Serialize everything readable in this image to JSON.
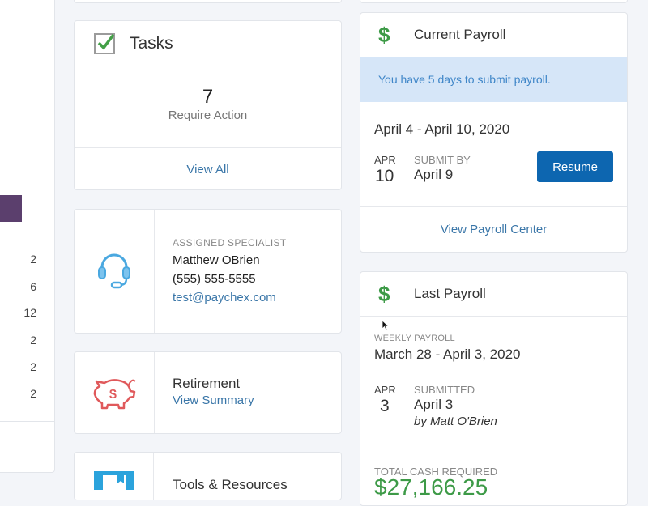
{
  "left_panel": {
    "values": [
      "2",
      "6",
      "12",
      "2",
      "2",
      "2"
    ],
    "swatch_color": "#5b3f6d"
  },
  "tasks": {
    "title": "Tasks",
    "count": "7",
    "count_label": "Require Action",
    "link": "View All"
  },
  "specialist": {
    "label": "ASSIGNED SPECIALIST",
    "name": "Matthew OBrien",
    "phone": "(555) 555-5555",
    "email": "test@paychex.com"
  },
  "retirement": {
    "title": "Retirement",
    "link": "View Summary"
  },
  "tools": {
    "title": "Tools & Resources"
  },
  "current_payroll": {
    "title": "Current Payroll",
    "banner": "You have 5 days to submit payroll.",
    "range": "April 4 - April 10, 2020",
    "month": "APR",
    "day": "10",
    "submit_label": "SUBMIT BY",
    "submit_date": "April 9",
    "resume_label": "Resume",
    "link": "View Payroll Center"
  },
  "last_payroll": {
    "title": "Last Payroll",
    "type_label": "WEEKLY PAYROLL",
    "range": "March 28 - April 3, 2020",
    "month": "APR",
    "day": "3",
    "status_label": "SUBMITTED",
    "status_date": "April 3",
    "by": "by  Matt O'Brien",
    "total_label": "TOTAL CASH REQUIRED",
    "total_amount": "$27,166.25"
  },
  "colors": {
    "accent": "#0d66b0",
    "dollar": "#3d9a47",
    "link": "#3a76a8",
    "banner_bg": "#d6e6f8"
  }
}
